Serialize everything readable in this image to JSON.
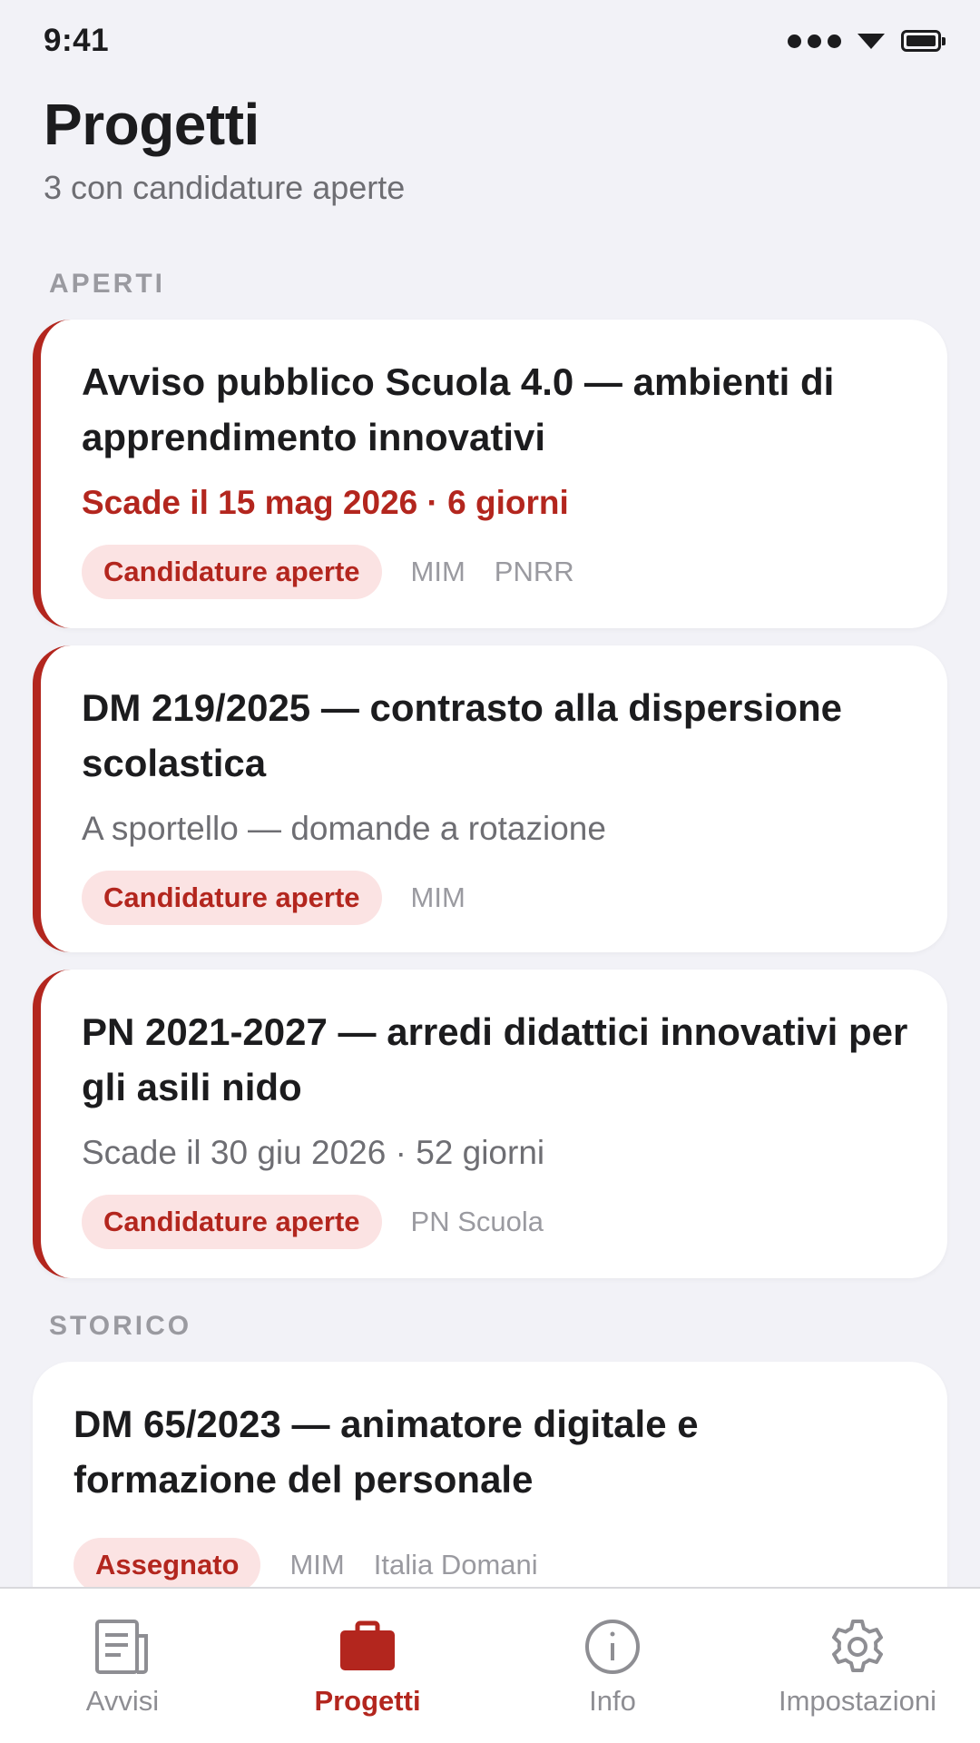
{
  "status_bar": {
    "time": "9:41"
  },
  "header": {
    "title": "Progetti",
    "subtitle": "3 con candidature aperte"
  },
  "sections": {
    "open_label": "APERTI",
    "history_label": "STORICO"
  },
  "open_projects": [
    {
      "title": "Avviso pubblico Scuola 4.0 — ambienti di apprendimento innovativi",
      "meta": "Scade il 15 mag 2026 · 6 giorni",
      "status": "Candidature aperte",
      "tags": [
        "MIM",
        "PNRR"
      ]
    },
    {
      "title": "DM 219/2025 — contrasto alla dispersione scolastica",
      "meta": "A sportello — domande a rotazione",
      "status": "Candidature aperte",
      "tags": [
        "MIM"
      ]
    },
    {
      "title": "PN 2021-2027 — arredi didattici innovativi per gli asili nido",
      "meta": "Scade il 30 giu 2026 · 52 giorni",
      "status": "Candidature aperte",
      "tags": [
        "PN Scuola"
      ]
    }
  ],
  "history_projects": [
    {
      "title": "DM 65/2023 — animatore digitale e formazione del personale",
      "status": "Assegnato",
      "tags": [
        "MIM",
        "Italia Domani"
      ]
    }
  ],
  "tab_bar": {
    "items": [
      {
        "label": "Avvisi",
        "icon": "document-icon"
      },
      {
        "label": "Progetti",
        "icon": "briefcase-icon"
      },
      {
        "label": "Info",
        "icon": "info-icon"
      },
      {
        "label": "Impostazioni",
        "icon": "gear-icon"
      }
    ],
    "active_index": 1
  },
  "colors": {
    "accent": "#b3261e",
    "pill_background": "#fbe3e3",
    "background": "#f2f2f7",
    "inactive": "#8e8e93"
  }
}
